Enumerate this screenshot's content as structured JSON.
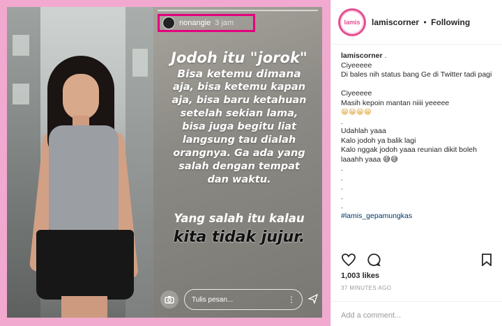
{
  "story": {
    "username": "nonangie",
    "time": "3 jam",
    "text_title": "Jodoh itu \"jorok\"",
    "text_lines": [
      "Bisa ketemu dimana",
      "aja, bisa ketemu kapan",
      "aja, bisa baru ketahuan",
      "setelah sekian lama,",
      "bisa juga begitu liat",
      "langsung tau dialah",
      "orangnya. Ga ada yang",
      "salah dengan tempat",
      "dan waktu."
    ],
    "quote_1": "Yang salah itu kalau",
    "quote_2": "kita tidak jujur.",
    "message_placeholder": "Tulis pesan...",
    "dots": "⋮",
    "camera_icon": "camera-icon",
    "send_icon": "send-icon"
  },
  "post": {
    "username": "lamiscorner",
    "separator": "•",
    "follow_status": "Following",
    "avatar_text": "lamis",
    "caption_user": "lamiscorner",
    "caption_user_suffix": " .",
    "caption_lines": [
      "Ciyeeeee",
      "Di bales nih status bang Ge di Twitter tadi pagi",
      "",
      "Ciyeeeee",
      "Masih kepoin mantan niiii yeeeee",
      "😁😁😁😁",
      ".",
      "Udahlah yaaa",
      "Kalo jodoh ya balik lagi",
      "Kalo nggak jodoh yaaa reunian dikit boleh laaahh yaaa 😅😅",
      ".",
      ".",
      ".",
      ".",
      "."
    ],
    "hashtag": "#lamis_gepamungkas",
    "likes": "1,003 likes",
    "time_ago": "37 MINUTES AGO",
    "comment_placeholder": "Add a comment..."
  },
  "colors": {
    "frame_pink": "#f1a9cf",
    "highlight_magenta": "#e4007f",
    "hashtag_blue": "#003569"
  }
}
